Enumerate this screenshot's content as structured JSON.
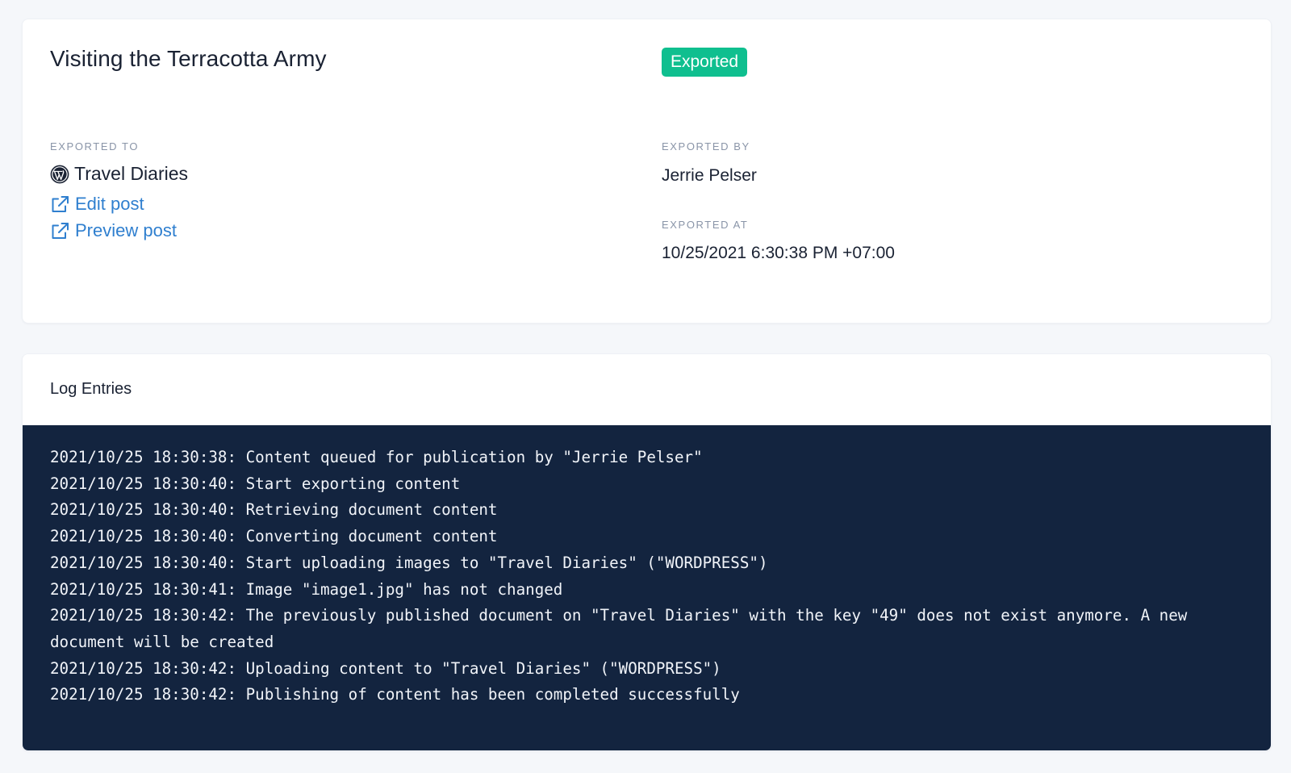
{
  "summary": {
    "title": "Visiting the Terracotta Army",
    "status": "Exported",
    "status_color": "#0fbf8f",
    "exported_to_label": "EXPORTED TO",
    "destination_icon": "wordpress-icon",
    "destination_name": "Travel Diaries",
    "edit_post_label": "Edit post",
    "preview_post_label": "Preview post",
    "link_icon": "external-link-icon",
    "exported_by_label": "EXPORTED BY",
    "exported_by": "Jerrie Pelser",
    "exported_at_label": "EXPORTED AT",
    "exported_at": "10/25/2021 6:30:38 PM +07:00"
  },
  "log": {
    "title": "Log Entries",
    "entries": [
      "2021/10/25 18:30:38: Content queued for publication by \"Jerrie Pelser\"",
      "2021/10/25 18:30:40: Start exporting content",
      "2021/10/25 18:30:40: Retrieving document content",
      "2021/10/25 18:30:40: Converting document content",
      "2021/10/25 18:30:40: Start uploading images to \"Travel Diaries\" (\"WORDPRESS\")",
      "2021/10/25 18:30:41: Image \"image1.jpg\" has not changed",
      "2021/10/25 18:30:42: The previously published document on \"Travel Diaries\" with the key \"49\" does not exist anymore. A new document will be created",
      "2021/10/25 18:30:42: Uploading content to \"Travel Diaries\" (\"WORDPRESS\")",
      "2021/10/25 18:30:42: Publishing of content has been completed successfully"
    ]
  }
}
